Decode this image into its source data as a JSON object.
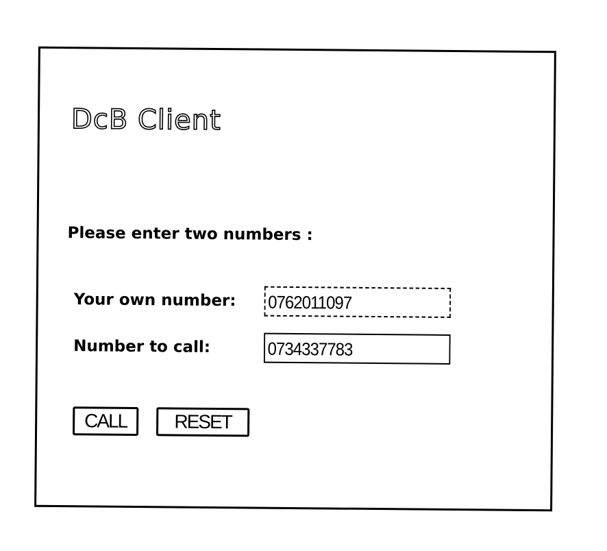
{
  "app": {
    "title": "DcB Client"
  },
  "form": {
    "prompt": "Please enter two numbers :",
    "own_number": {
      "label": "Your own number:",
      "value": "0762011097"
    },
    "number_to_call": {
      "label": "Number to call:",
      "value": "0734337783"
    }
  },
  "buttons": {
    "call_label": "CALL",
    "reset_label": "RESET"
  }
}
